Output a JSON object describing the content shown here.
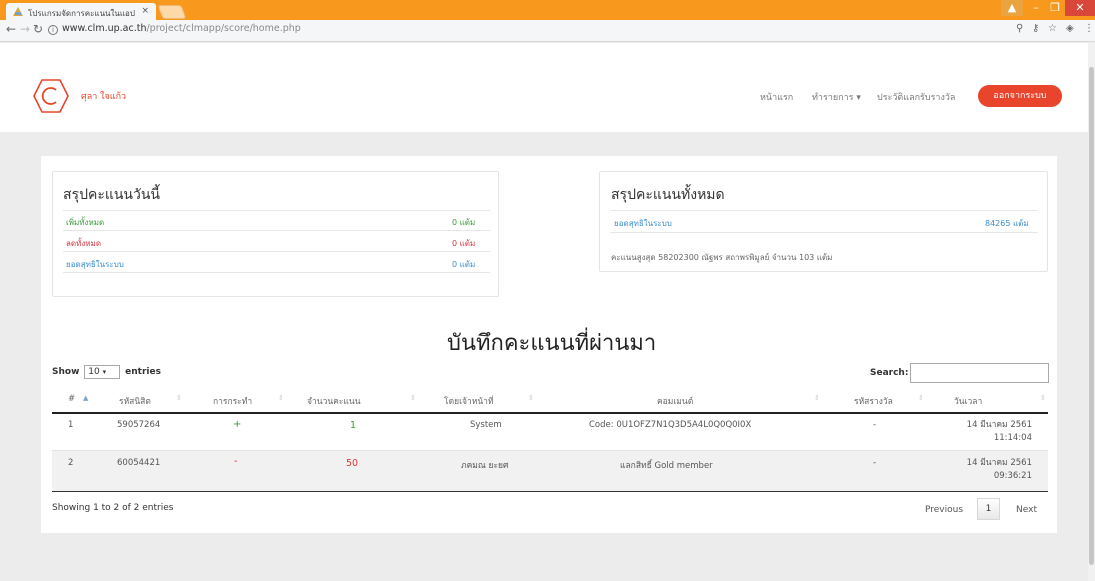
{
  "browser": {
    "tab_title": "โปรแกรมจัดการคะแนนในแอป",
    "tab_close": "×",
    "url_host": "www.clm.up.ac.th",
    "url_path": "/project/clmapp/score/home.php",
    "info_icon": "i"
  },
  "header": {
    "username": "ศุลา ใจแก้ว",
    "nav": {
      "home": "หน้าแรก",
      "transactions": "ทำรายการ ▾",
      "redeem_history": "ประวัติแลกรับรางวัล"
    },
    "logout": "ออกจากระบบ"
  },
  "today_summary": {
    "title": "สรุปคะแนนวันนี้",
    "rows": [
      {
        "label": "เพิ่มทั้งหมด",
        "value": "0 แต้ม",
        "color": "#3a9a37"
      },
      {
        "label": "ลดทั้งหมด",
        "value": "0 แต้ม",
        "color": "#d9363e"
      },
      {
        "label": "ยอดสุทธิในระบบ",
        "value": "0 แต้ม",
        "color": "#3a8ed0"
      }
    ]
  },
  "total_summary": {
    "title": "สรุปคะแนนทั้งหมด",
    "net_label": "ยอดสุทธิในระบบ",
    "net_value": "84265 แต้ม",
    "top_score": "คะแนนสูงสุด   58202300  ณัฐพร สถาพรพิมูลย์   จำนวน  103  แต้ม"
  },
  "history": {
    "title": "บันทึกคะแนนที่ผ่านมา",
    "show_label": "Show",
    "entries_value": "10",
    "entries_label": "entries",
    "search_label": "Search:",
    "search_value": "",
    "columns": [
      "#",
      "รหัสนิสิต",
      "การกระทำ",
      "จำนวนคะแนน",
      "โดยเจ้าหน้าที่",
      "คอมเมนต์",
      "รหัสรางวัล",
      "วันเวลา"
    ],
    "rows": [
      {
        "num": "1",
        "student_id": "59057264",
        "action": "+",
        "points": "1",
        "staff": "System",
        "comment": "Code: 0U1OFZ7N1Q3D5A4L0Q0Q0I0X",
        "reward_id": "-",
        "date": "14 มีนาคม 2561",
        "time": "11:14:04"
      },
      {
        "num": "2",
        "student_id": "60054421",
        "action": "-",
        "points": "50",
        "staff": "ภคมณ ยะยศ",
        "comment": "แลกสิทธิ์ Gold member",
        "reward_id": "-",
        "date": "14 มีนาคม 2561",
        "time": "09:36:21"
      }
    ],
    "info": "Showing 1 to 2 of 2 entries",
    "previous": "Previous",
    "current_page": "1",
    "next": "Next"
  },
  "colors": {
    "accent": "#e8452c",
    "browser_bar": "#f8991d",
    "plus": "#3a9a37",
    "minus": "#d9363e",
    "link": "#3a8ed0"
  }
}
